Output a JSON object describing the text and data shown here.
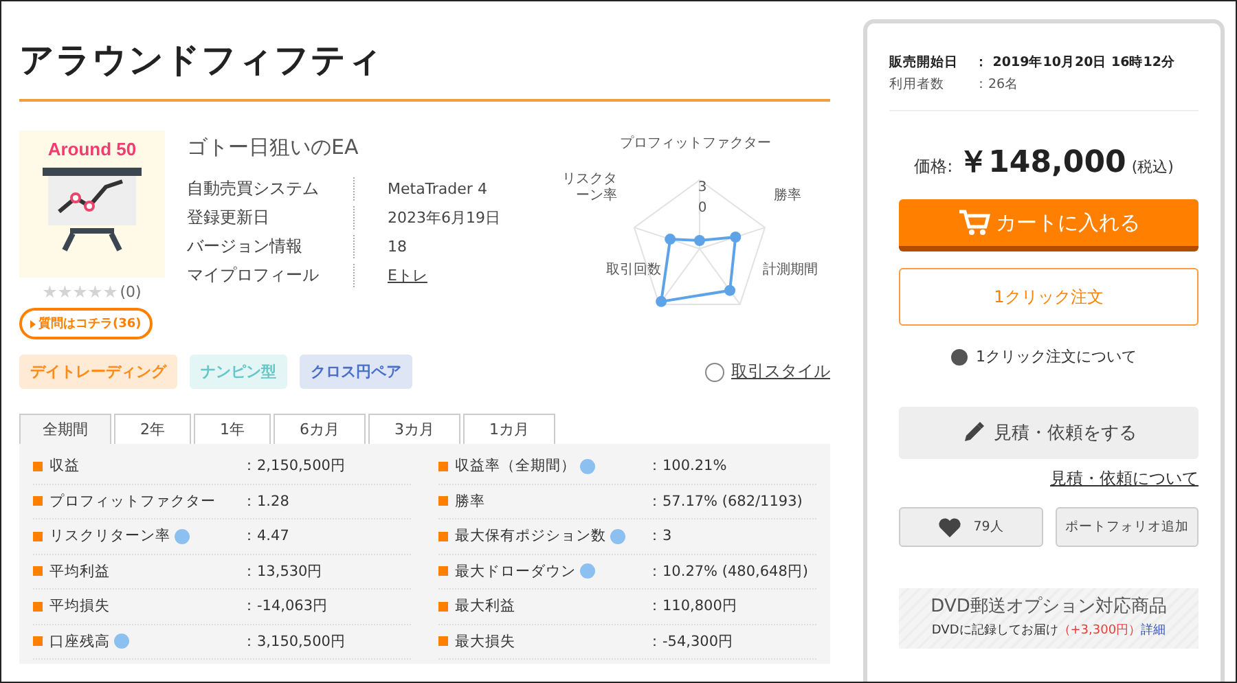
{
  "title": "アラウンドフィフティ",
  "product": {
    "name": "ゴトー日狙いのEA",
    "thumbnail_text": "Around 50",
    "stars": 0,
    "review_count": "(0)",
    "question_button": "質問はコチラ(36)",
    "info": [
      {
        "label": "自動売買システム",
        "value": "MetaTrader 4",
        "link": false
      },
      {
        "label": "登録更新日",
        "value": "2023年6月19日",
        "link": false
      },
      {
        "label": "バージョン情報",
        "value": "18",
        "link": false
      },
      {
        "label": "マイプロフィール",
        "value": "Eトレ",
        "link": true
      }
    ]
  },
  "radar": {
    "labels": [
      "プロフィットファクター",
      "勝率",
      "計測期間",
      "取引回数",
      "リスクターン率"
    ],
    "ticks": [
      "3",
      "0"
    ]
  },
  "tags": [
    {
      "label": "デイトレーディング",
      "color": "#ff8c1a"
    },
    {
      "label": "ナンピン型",
      "color": "#66c7c7"
    },
    {
      "label": "クロス円ペア",
      "color": "#4a6fc9"
    }
  ],
  "style_link": "取引スタイル",
  "tabs": [
    {
      "label": "全期間",
      "selected": true
    },
    {
      "label": "2年",
      "selected": false
    },
    {
      "label": "1年",
      "selected": false
    },
    {
      "label": "6カ月",
      "selected": false
    },
    {
      "label": "3カ月",
      "selected": false
    },
    {
      "label": "1カ月",
      "selected": false
    }
  ],
  "stats": [
    {
      "label": "収益",
      "value": "：2,150,500円",
      "help": false
    },
    {
      "label": "収益率（全期間）",
      "value": "：100.21%",
      "help": true
    },
    {
      "label": "プロフィットファクター",
      "value": "：1.28",
      "help": false
    },
    {
      "label": "勝率",
      "value": "：57.17% (682/1193)",
      "help": false
    },
    {
      "label": "リスクリターン率",
      "value": "：4.47",
      "help": true
    },
    {
      "label": "最大保有ポジション数",
      "value": "：3",
      "help": true
    },
    {
      "label": "平均利益",
      "value": "：13,530円",
      "help": false
    },
    {
      "label": "最大ドローダウン",
      "value": "：10.27% (480,648円)",
      "help": true
    },
    {
      "label": "平均損失",
      "value": "：-14,063円",
      "help": false
    },
    {
      "label": "最大利益",
      "value": "：110,800円",
      "help": false
    },
    {
      "label": "口座残高",
      "value": "：3,150,500円",
      "help": true
    },
    {
      "label": "最大損失",
      "value": "：-54,300円",
      "help": false
    }
  ],
  "sidebar": {
    "meta": [
      {
        "label": "販売開始日",
        "value": "：  2019年10月20日 16時12分",
        "bold": true
      },
      {
        "label": "利用者数",
        "value": "：26名",
        "bold": false
      }
    ],
    "price_label": "価格:",
    "price": "￥148,000",
    "tax": "(税込)",
    "cart_button": "カートに入れる",
    "one_click_button": "1クリック注文",
    "one_click_help": "1クリック注文について",
    "quote_button": "見積・依頼をする",
    "quote_link": "見積・依頼について",
    "like_count": "79人",
    "portfolio_button": "ポートフォリオ追加",
    "dvd": {
      "title": "DVD郵送オプション対応商品",
      "text": "DVDに記録してお届け",
      "price": "（+3,300円）",
      "link": "詳細"
    }
  }
}
